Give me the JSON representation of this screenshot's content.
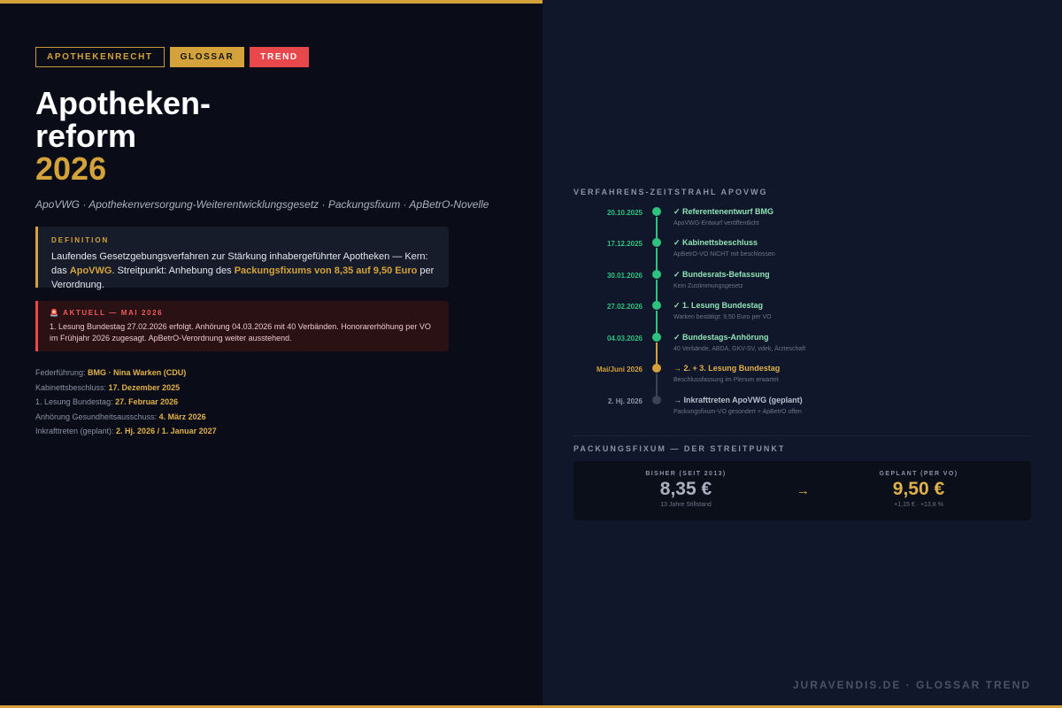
{
  "tags": [
    "APOTHEKENRECHT",
    "GLOSSAR",
    "TREND"
  ],
  "title": {
    "line1": "Apotheken-",
    "line2": "reform",
    "year": "2026"
  },
  "subtitle": "ApoVWG · Apothekenversorgung-Weiterentwicklungsgesetz · Packungsfixum · ApBetrO-Novelle",
  "definition": {
    "label": "DEFINITION",
    "text1": "Laufendes Gesetzgebungsverfahren zur Stärkung inhabergeführter Apotheken — Kern: das ",
    "hl1": "ApoVWG",
    "text2": ". Streitpunkt: Anhebung des ",
    "hl2": "Packungsfixums von 8,35 auf 9,50 Euro",
    "text3": " per Verordnung."
  },
  "alert": {
    "label": "🚨 AKTUELL — MAI 2026",
    "text": "1. Lesung Bundestag 27.02.2026 erfolgt. Anhörung 04.03.2026 mit 40 Verbänden. Honorarerhöhung per VO im Frühjahr 2026 zugesagt. ApBetrO-Verordnung weiter ausstehend."
  },
  "facts": [
    {
      "label": "Federführung: ",
      "value": "BMG · Nina Warken (CDU)"
    },
    {
      "label": "Kabinettsbeschluss: ",
      "value": "17. Dezember 2025"
    },
    {
      "label": "1. Lesung Bundestag: ",
      "value": "27. Februar 2026"
    },
    {
      "label": "Anhörung Gesundheitsausschuss: ",
      "value": "4. März 2026"
    },
    {
      "label": "Inkrafttreten (geplant): ",
      "value": "2. Hj. 2026 / 1. Januar 2027"
    }
  ],
  "timeline": {
    "heading": "VERFAHRENS-ZEITSTRAHL APOVWG",
    "items": [
      {
        "date": "20.10.2025",
        "title": "✓ Referentenentwurf BMG",
        "sub": "ApoVWG-Entwurf veröffentlicht",
        "status": "done"
      },
      {
        "date": "17.12.2025",
        "title": "✓ Kabinettsbeschluss",
        "sub": "ApBetrO-VO NICHT mit beschlossen",
        "status": "done"
      },
      {
        "date": "30.01.2026",
        "title": "✓ Bundesrats-Befassung",
        "sub": "Kein Zustimmungsgesetz",
        "status": "done"
      },
      {
        "date": "27.02.2026",
        "title": "✓ 1. Lesung Bundestag",
        "sub": "Warken bestätigt: 9,50 Euro per VO",
        "status": "done"
      },
      {
        "date": "04.03.2026",
        "title": "✓ Bundestags-Anhörung",
        "sub": "40 Verbände, ABDA, GKV-SV, vdek, Ärzteschaft",
        "status": "done"
      },
      {
        "date": "Mai/Juni 2026",
        "title": "→ 2. + 3. Lesung Bundestag",
        "sub": "Beschlussfassung im Plenum erwartet",
        "status": "current"
      },
      {
        "date": "2. Hj. 2026",
        "title": "→ Inkrafttreten ApoVWG (geplant)",
        "sub": "Packungsfixum-VO gesondert + ApBetrO offen",
        "status": "future"
      }
    ]
  },
  "fixum": {
    "heading": "PACKUNGSFIXUM — DER STREITPUNKT",
    "before": {
      "label": "BISHER (SEIT 2013)",
      "value": "8,35 €",
      "note": "13 Jahre Stillstand"
    },
    "arrow": "→",
    "after": {
      "label": "GEPLANT (PER VO)",
      "value": "9,50 €",
      "note": "+1,15 € · +13,8 %"
    }
  },
  "footer": "JURAVENDIS.DE · GLOSSAR TREND",
  "colors": {
    "accent": "#d4a23a",
    "alert": "#e8474b",
    "done": "#2ec27e",
    "future": "#3a4254"
  }
}
